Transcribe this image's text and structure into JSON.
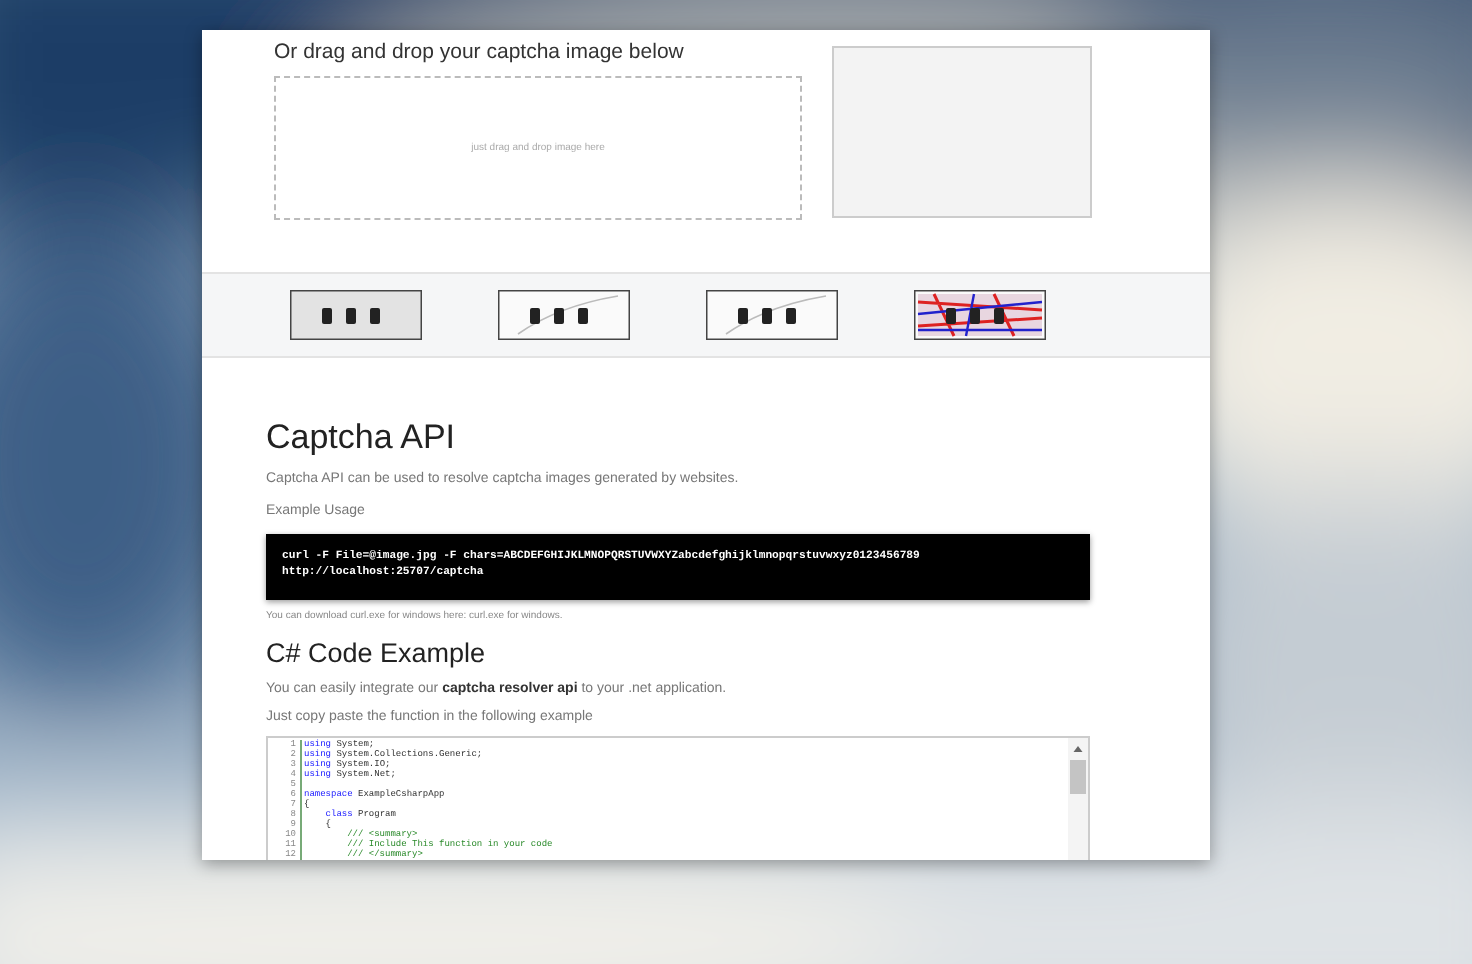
{
  "upload": {
    "heading": "Or drag and drop your captcha image below",
    "dropzone": {
      "placeholder": "just drag and drop image here"
    }
  },
  "api": {
    "title": "Captcha API",
    "description": "Captcha API can be used to resolve captcha images generated by websites.",
    "usage_label": "Example Usage",
    "command": [
      "curl -F File=@image.jpg -F chars=ABCDEFGHIJKLMNOPQRSTUVWXYZabcdefghijklmnopqrstuvwxyz0123456789",
      "http://localhost:25707/captcha"
    ],
    "note": "You can download curl.exe for windows here: curl.exe for windows."
  },
  "csharp": {
    "title": "C# Code Example",
    "intro": "You can easily integrate our **captcha resolver api** to your .net application.",
    "instruction": "Just copy paste the function in the following example",
    "code_lines": [
      {
        "number": "1",
        "tokens": [
          {
            "kind": "keyword",
            "text": "using"
          },
          {
            "kind": "plain",
            "text": " System;"
          }
        ]
      },
      {
        "number": "2",
        "tokens": [
          {
            "kind": "keyword",
            "text": "using"
          },
          {
            "kind": "plain",
            "text": " System.Collections.Generic;"
          }
        ]
      },
      {
        "number": "3",
        "tokens": [
          {
            "kind": "keyword",
            "text": "using"
          },
          {
            "kind": "plain",
            "text": " System.IO;"
          }
        ]
      },
      {
        "number": "4",
        "tokens": [
          {
            "kind": "keyword",
            "text": "using"
          },
          {
            "kind": "plain",
            "text": " System.Net;"
          }
        ]
      },
      {
        "number": "5"
      },
      {
        "number": "6",
        "tokens": [
          {
            "kind": "keyword",
            "text": "namespace"
          },
          {
            "kind": "plain",
            "text": " ExampleCsharpApp"
          }
        ]
      },
      {
        "number": "7",
        "tokens": [
          {
            "kind": "plain",
            "text": "{"
          }
        ]
      },
      {
        "number": "8",
        "tokens": [
          {
            "kind": "keyword",
            "text": "    class"
          },
          {
            "kind": "plain",
            "text": " Program"
          }
        ]
      },
      {
        "number": "9",
        "tokens": [
          {
            "kind": "plain",
            "text": "    {"
          }
        ]
      },
      {
        "number": "10",
        "tokens": [
          {
            "kind": "comment",
            "text": "        /// <summary>"
          }
        ]
      },
      {
        "number": "11",
        "tokens": [
          {
            "kind": "comment",
            "text": "        /// Include This function in your code"
          }
        ]
      },
      {
        "number": "12",
        "tokens": [
          {
            "kind": "comment",
            "text": "        /// </summary>"
          }
        ]
      }
    ]
  }
}
